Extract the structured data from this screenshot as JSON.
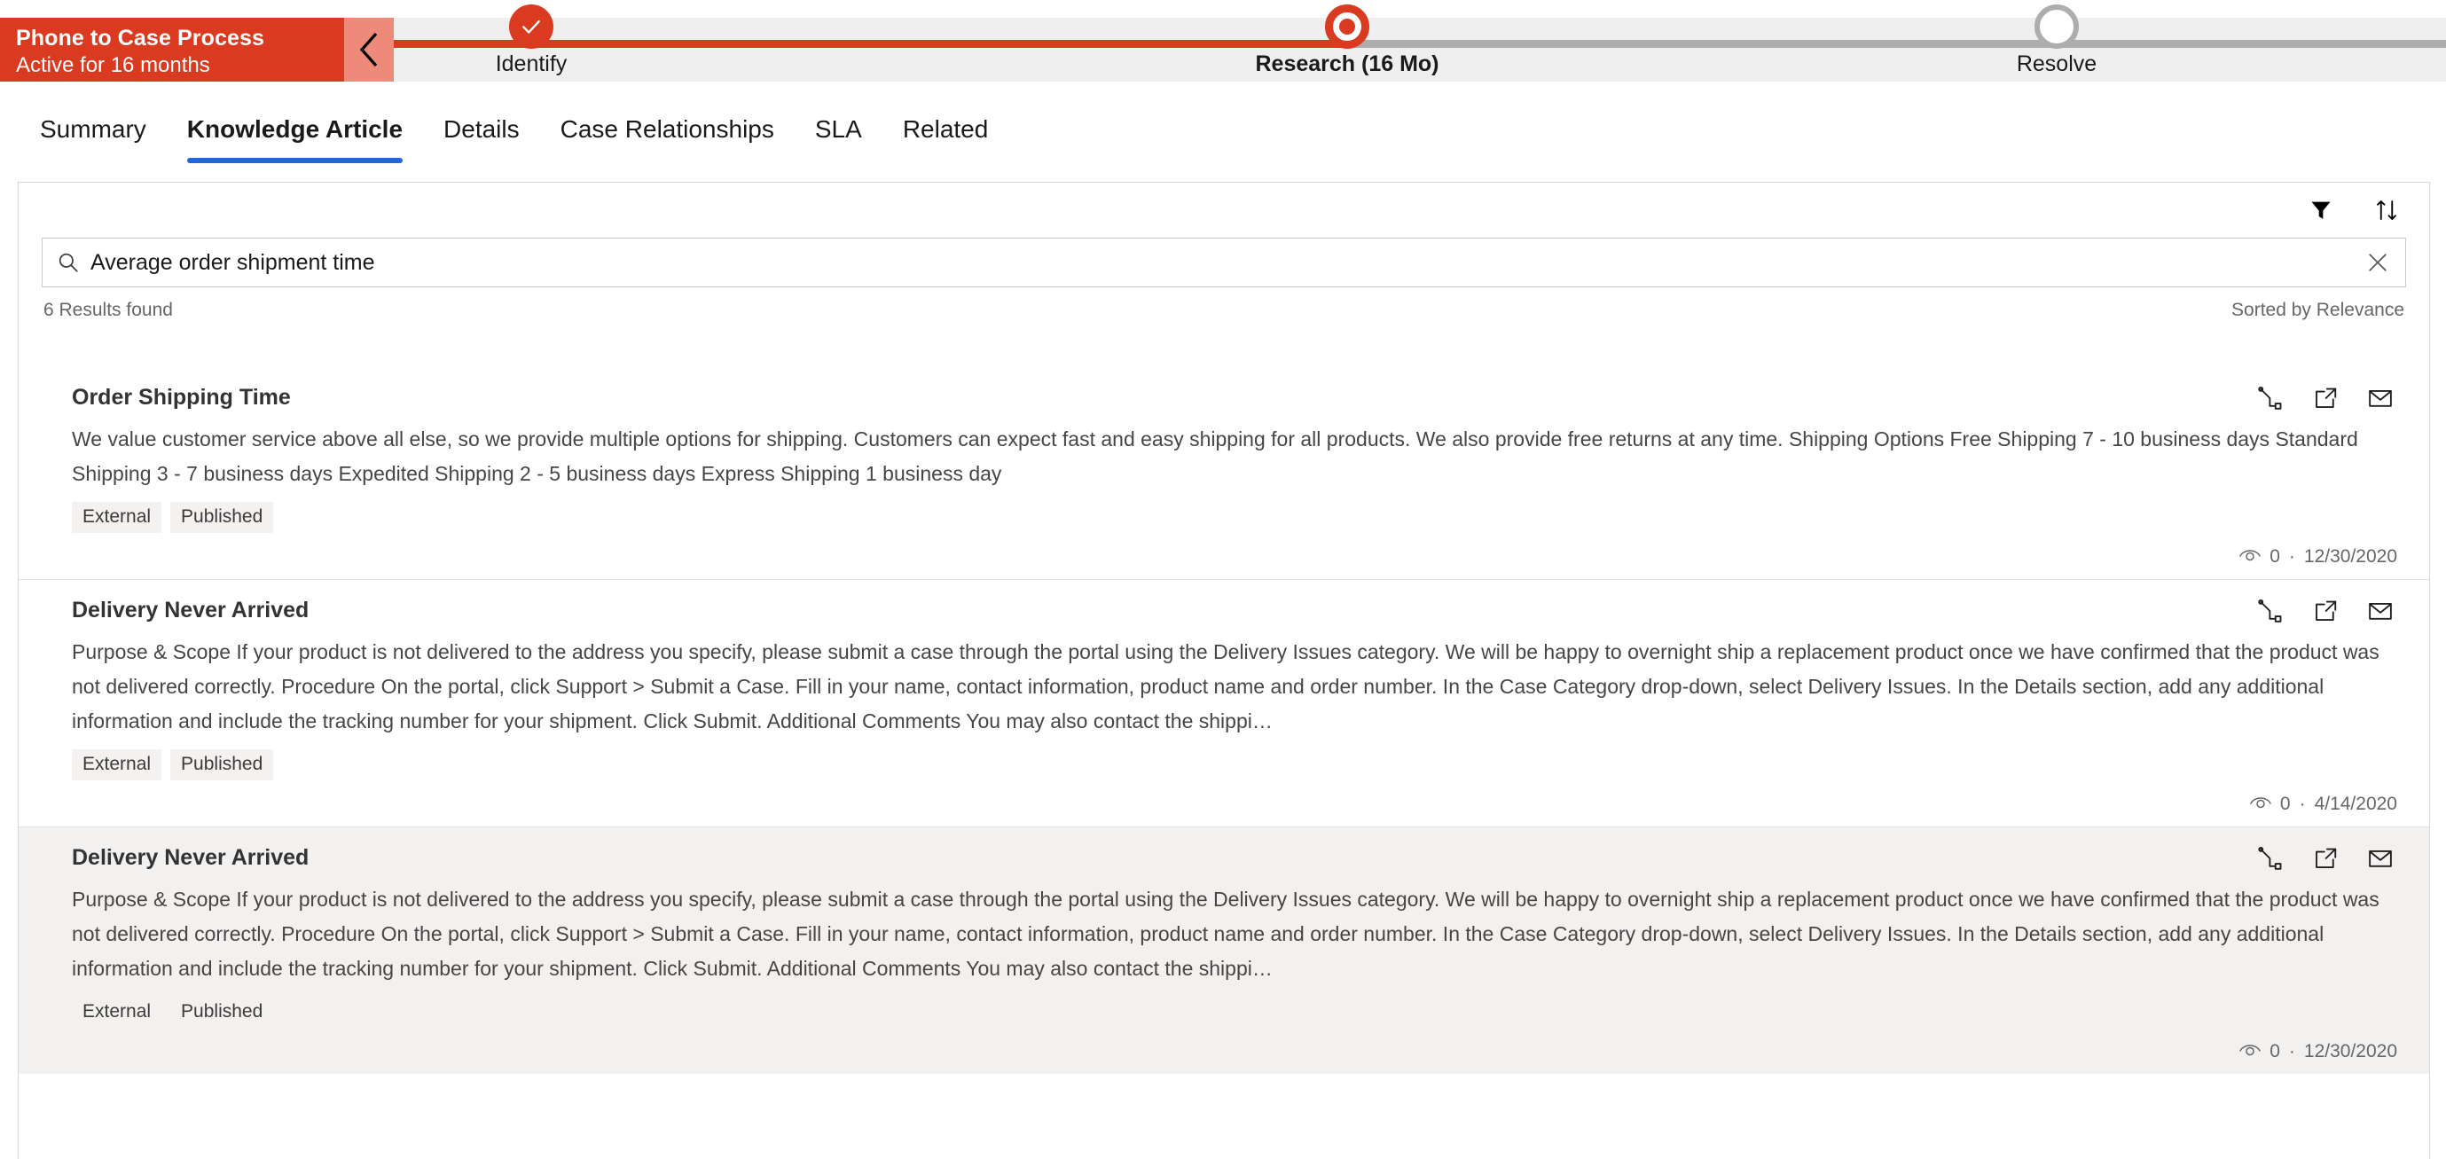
{
  "process": {
    "title": "Phone to Case Process",
    "subtitle": "Active for 16 months",
    "collapse_icon": "chevron-left-icon",
    "stages": [
      {
        "label": "Identify",
        "state": "completed",
        "icon": "check-icon"
      },
      {
        "label": "Research  (16 Mo)",
        "state": "active",
        "icon": "dot-icon"
      },
      {
        "label": "Resolve",
        "state": "future",
        "icon": "circle-icon"
      }
    ]
  },
  "tabs": [
    {
      "label": "Summary",
      "active": false
    },
    {
      "label": "Knowledge Article",
      "active": true
    },
    {
      "label": "Details",
      "active": false
    },
    {
      "label": "Case Relationships",
      "active": false
    },
    {
      "label": "SLA",
      "active": false
    },
    {
      "label": "Related",
      "active": false
    }
  ],
  "toolbar": {
    "filter_icon": "filter-icon",
    "sort_icon": "sort-icon"
  },
  "search": {
    "icon": "search-icon",
    "value": "Average order shipment time",
    "placeholder": "Search knowledge articles",
    "clear_icon": "close-icon"
  },
  "results_meta": {
    "count_label": "6 Results found",
    "sort_label": "Sorted by Relevance"
  },
  "results": [
    {
      "title": "Order Shipping Time",
      "body": "We value customer service above all else, so we provide multiple options for shipping. Customers can expect fast and easy shipping for all products. We also provide free returns at any time. Shipping Options Free Shipping 7 - 10 business days Standard Shipping 3 - 7 business days Expedited Shipping 2 - 5 business days Express Shipping 1 business day",
      "badges": [
        "External",
        "Published"
      ],
      "views": "0",
      "date": "12/30/2020",
      "highlight": false,
      "actions": [
        "link-article-icon",
        "open-in-new-window-icon",
        "email-article-icon"
      ]
    },
    {
      "title": "Delivery Never Arrived",
      "body": "Purpose & Scope If your product is not delivered to the address you specify, please submit a case through the portal using the Delivery Issues category. We will be happy to overnight ship a replacement product once we have confirmed that the product was not delivered correctly. Procedure On the portal, click Support > Submit a Case. Fill in your name, contact information, product name and order number. In the Case Category drop-down, select Delivery Issues. In the Details section, add any additional information and include the tracking number for your shipment. Click Submit. Additional Comments You may also contact the shippi…",
      "badges": [
        "External",
        "Published"
      ],
      "views": "0",
      "date": "4/14/2020",
      "highlight": false,
      "actions": [
        "link-article-icon",
        "open-in-new-window-icon",
        "email-article-icon"
      ]
    },
    {
      "title": "Delivery Never Arrived",
      "body": "Purpose & Scope If your product is not delivered to the address you specify, please submit a case through the portal using the Delivery Issues category. We will be happy to overnight ship a replacement product once we have confirmed that the product was not delivered correctly. Procedure On the portal, click Support > Submit a Case. Fill in your name, contact information, product name and order number. In the Case Category drop-down, select Delivery Issues. In the Details section, add any additional information and include the tracking number for your shipment. Click Submit. Additional Comments You may also contact the shippi…",
      "badges": [
        "External",
        "Published"
      ],
      "views": "0",
      "date": "12/30/2020",
      "highlight": true,
      "actions": [
        "link-article-icon",
        "open-in-new-window-icon",
        "email-article-icon"
      ]
    }
  ],
  "colors": {
    "brand_red": "#da3b20",
    "brand_red_light": "#ee8a79",
    "tab_accent": "#2266dd",
    "rail_todo": "#adadad",
    "highlight_bg": "#f2f1f0"
  }
}
